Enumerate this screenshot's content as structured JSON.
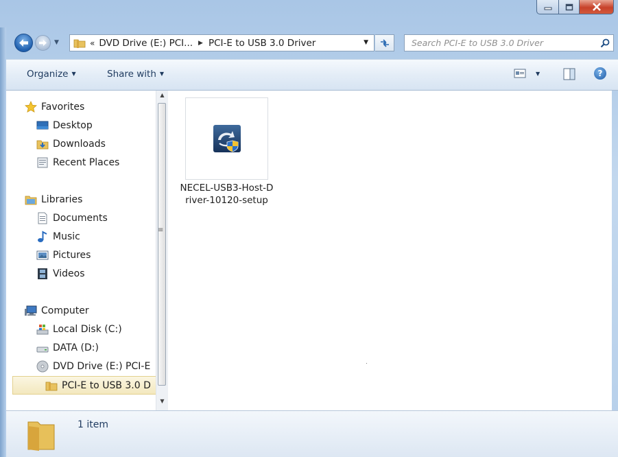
{
  "window": {
    "caption_buttons": {
      "minimize": "minimize",
      "maximize": "maximize",
      "close": "close"
    }
  },
  "address_bar": {
    "overflow": "«",
    "crumbs": [
      "DVD Drive (E:) PCI...",
      "PCI-E to USB 3.0 Driver"
    ]
  },
  "search": {
    "placeholder": "Search PCI-E to USB 3.0 Driver"
  },
  "toolbar": {
    "organize_label": "Organize",
    "share_label": "Share with"
  },
  "navigation": {
    "favorites": {
      "label": "Favorites",
      "items": [
        "Desktop",
        "Downloads",
        "Recent Places"
      ]
    },
    "libraries": {
      "label": "Libraries",
      "items": [
        "Documents",
        "Music",
        "Pictures",
        "Videos"
      ]
    },
    "computer": {
      "label": "Computer",
      "items": [
        "Local Disk (C:)",
        "DATA (D:)",
        "DVD Drive (E:) PCI-E",
        "PCI-E to USB 3.0 D"
      ]
    },
    "selected": "PCI-E to USB 3.0 D"
  },
  "files": [
    {
      "name": "NECEL-USB3-Host-Driver-10120-setup",
      "icon": "setup-shield-icon"
    }
  ],
  "details": {
    "item_count": "1 item"
  },
  "colors": {
    "title_bar": "#b6cfea",
    "command_bar": "#e4edf7",
    "selection": "#f3e8be",
    "close_button": "#c7422a"
  }
}
